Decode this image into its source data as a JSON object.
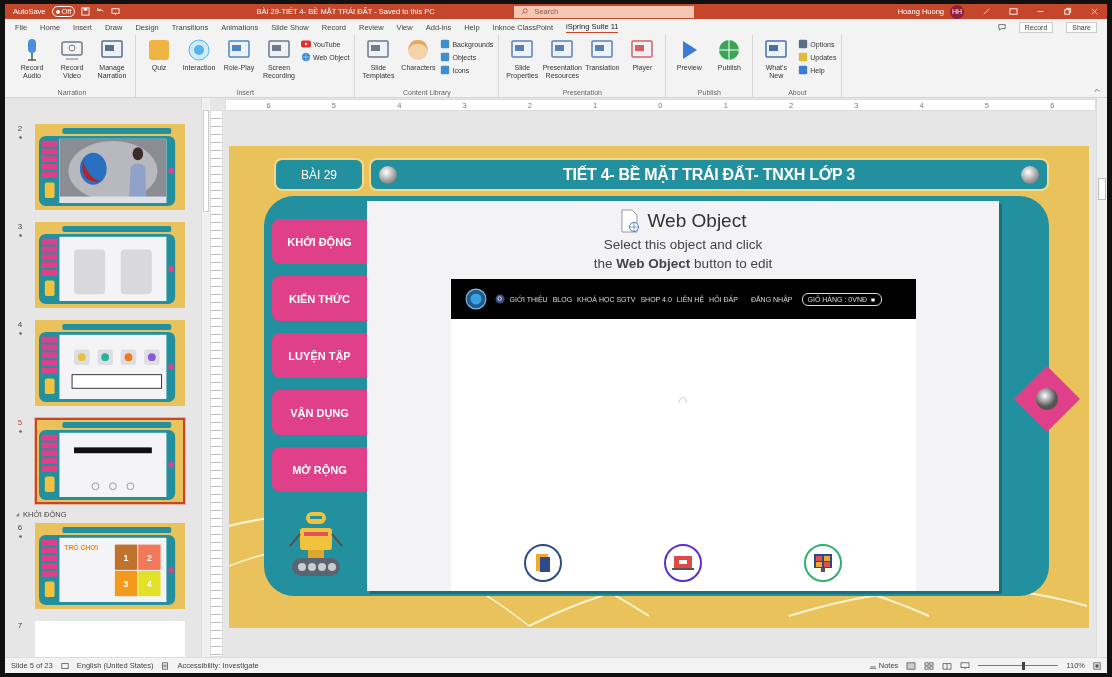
{
  "titlebar": {
    "autosave_label": "AutoSave",
    "autosave_state": "Off",
    "autosave_on": false,
    "document_title": "BÀI 29-TIẾT 4- BỀ MẶT TRÁI ĐẤT - Saved to this PC",
    "search_placeholder": "Search",
    "user_name": "Hoang Huong",
    "user_initials": "HH"
  },
  "ribbon_tabs": [
    {
      "label": "File",
      "selected": false
    },
    {
      "label": "Home",
      "selected": false
    },
    {
      "label": "Insert",
      "selected": false
    },
    {
      "label": "Draw",
      "selected": false
    },
    {
      "label": "Design",
      "selected": false
    },
    {
      "label": "Transitions",
      "selected": false
    },
    {
      "label": "Animations",
      "selected": false
    },
    {
      "label": "Slide Show",
      "selected": false
    },
    {
      "label": "Record",
      "selected": false
    },
    {
      "label": "Review",
      "selected": false
    },
    {
      "label": "View",
      "selected": false
    },
    {
      "label": "Add-ins",
      "selected": false
    },
    {
      "label": "Help",
      "selected": false
    },
    {
      "label": "Inknoe ClassPoint",
      "selected": false
    },
    {
      "label": "iSpring Suite 11",
      "selected": true
    }
  ],
  "ribbon_actions": [
    {
      "label": "Record"
    },
    {
      "label": "Share"
    }
  ],
  "ribbon_groups": [
    {
      "name": "Narration",
      "buttons": [
        {
          "label": "Record Audio",
          "kind": "large"
        },
        {
          "label": "Record Video",
          "kind": "large"
        },
        {
          "label": "Manage Narration",
          "kind": "large"
        }
      ]
    },
    {
      "name": "Insert",
      "buttons": [
        {
          "label": "Quiz",
          "kind": "large"
        },
        {
          "label": "Interaction",
          "kind": "large"
        },
        {
          "label": "Role-Play",
          "kind": "large"
        },
        {
          "label": "Screen Recording",
          "kind": "large"
        },
        {
          "label": "YouTube",
          "kind": "small"
        },
        {
          "label": "Web Object",
          "kind": "small"
        }
      ]
    },
    {
      "name": "Content Library",
      "buttons": [
        {
          "label": "Slide Templates",
          "kind": "large"
        },
        {
          "label": "Characters",
          "kind": "large"
        },
        {
          "label": "Backgrounds",
          "kind": "small"
        },
        {
          "label": "Objects",
          "kind": "small"
        },
        {
          "label": "Icons",
          "kind": "small"
        }
      ]
    },
    {
      "name": "Presentation",
      "buttons": [
        {
          "label": "Slide Properties",
          "kind": "large"
        },
        {
          "label": "Presentation Resources",
          "kind": "large"
        },
        {
          "label": "Translation",
          "kind": "large"
        },
        {
          "label": "Player",
          "kind": "large"
        }
      ]
    },
    {
      "name": "Publish",
      "buttons": [
        {
          "label": "Preview",
          "kind": "large"
        },
        {
          "label": "Publish",
          "kind": "large"
        }
      ]
    },
    {
      "name": "About",
      "buttons": [
        {
          "label": "What's New",
          "kind": "large"
        },
        {
          "label": "Options",
          "kind": "small"
        },
        {
          "label": "Updates",
          "kind": "small"
        },
        {
          "label": "Help",
          "kind": "small"
        }
      ]
    }
  ],
  "ruler_marks": [
    "6",
    "5",
    "4",
    "3",
    "2",
    "1",
    "0",
    "1",
    "2",
    "3",
    "4",
    "5",
    "6"
  ],
  "slides_panel": [
    {
      "kind": "video",
      "number": "2",
      "selected": false
    },
    {
      "kind": "text",
      "number": "3",
      "selected": false
    },
    {
      "kind": "cards",
      "number": "4",
      "selected": false
    },
    {
      "kind": "web",
      "number": "5",
      "selected": true
    },
    {
      "kind": "section",
      "label": "KHỞI ĐỘNG"
    },
    {
      "kind": "puzzle",
      "number": "6",
      "selected": false,
      "game_title": "TRÒ CHƠI",
      "pieces": [
        "1",
        "2",
        "3",
        "4"
      ]
    },
    {
      "kind": "blank",
      "number": "7",
      "selected": false
    }
  ],
  "slide": {
    "lesson_badge": "BÀI 29",
    "title": "TIẾT 4- BỀ MẶT TRÁI ĐẤT- TNXH LỚP 3",
    "nav_buttons": [
      "KHỞI ĐỘNG",
      "KIẾN THỨC",
      "LUYỆN TẬP",
      "VẬN DỤNG",
      "MỞ RỘNG"
    ],
    "web_object": {
      "heading": "Web Object",
      "lines": [
        "Select this object and click",
        "the **Web Object**  button to edit"
      ],
      "site_nav": [
        "GIỚI THIỆU",
        "BLOG",
        "KHOÁ HỌC SGTV",
        "SHOP 4.0",
        "LIÊN HỆ",
        "HỎI ĐÁP"
      ],
      "login": "ĐĂNG NHẬP",
      "cart": "GIỎ HÀNG : 0VNĐ"
    }
  },
  "status_bar": {
    "slide_info": "Slide 5 of 23",
    "language": "English (United States)",
    "accessibility": "Accessibility: Investigate",
    "notes": "Notes",
    "zoom": {
      "level": 0.55,
      "reading": "110%"
    }
  }
}
